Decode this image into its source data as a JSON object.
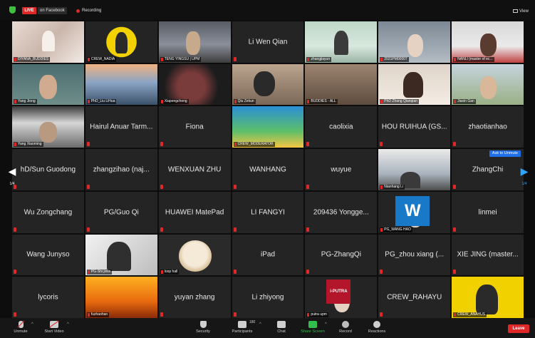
{
  "top_bar": {
    "live_badge": "LIVE",
    "live_target": "on Facebook",
    "recording": "Recording",
    "view_button": "View"
  },
  "tiles": [
    {
      "label": "DIYANA_BUDDIES",
      "video": true,
      "photo": "f1",
      "active": true
    },
    {
      "label": "CREW_NADIA",
      "video": true,
      "photo": "yellow"
    },
    {
      "label": "TENG YINGSU | UPM",
      "video": true,
      "photo": "room"
    },
    {
      "name": "Li Wen Qian",
      "video": false
    },
    {
      "label": "zhangjiayun",
      "video": true,
      "photo": "green"
    },
    {
      "label": "2021PM00007",
      "video": true,
      "photo": "gray"
    },
    {
      "label": "NANLI (master of ec...",
      "video": true,
      "photo": "red"
    },
    {
      "label": "Yang Jiong",
      "video": true,
      "photo": "teal"
    },
    {
      "label": "PhD_Liu LiHua",
      "video": true,
      "photo": "sky"
    },
    {
      "label": "Xiapengcheng",
      "video": true,
      "photo": "dark"
    },
    {
      "label": "Qiu Zekun",
      "video": true,
      "photo": "lamp"
    },
    {
      "label": "BUDDIES - ALL",
      "video": true,
      "photo": "group"
    },
    {
      "label": "PhD Zhang Qianqian",
      "video": true,
      "photo": "girl"
    },
    {
      "label": "Jiaxin Gan",
      "video": true,
      "photo": "outdoor"
    },
    {
      "label": "Yang Xiaoming",
      "video": true,
      "photo": "window"
    },
    {
      "name": "Hairul Anuar Tarm...",
      "video": false
    },
    {
      "name": "Fiona",
      "video": false
    },
    {
      "label": "CREW_MODERATOR",
      "video": true,
      "photo": "mod"
    },
    {
      "name": "caolixia",
      "video": false
    },
    {
      "name": "HOU RUIHUA (GS...",
      "video": false
    },
    {
      "name": "zhaotianhao",
      "video": false
    },
    {
      "name": "hD/Sun Guodong",
      "video": false
    },
    {
      "name": "zhangzihao (naj...",
      "video": false
    },
    {
      "name": "WENXUAN ZHU",
      "video": false
    },
    {
      "name": "WANHANG",
      "video": false
    },
    {
      "name": "wuyue",
      "video": false
    },
    {
      "label": "Nianhang Li",
      "video": true,
      "photo": "office"
    },
    {
      "name": "ZhangChi",
      "video": false,
      "ask_unmute": "Ask to Unmute"
    },
    {
      "name": "Wu Zongchang",
      "video": false
    },
    {
      "name": "PG/Guo Qi",
      "video": false
    },
    {
      "name": "HUAWEI MatePad",
      "video": false
    },
    {
      "name": "LI FANGYI",
      "video": false
    },
    {
      "name": "209436 Yongge...",
      "video": false
    },
    {
      "label": "PG_WANG HAO",
      "video": true,
      "photo": "wlogo",
      "logo_text": "W"
    },
    {
      "name": "linmei",
      "video": false
    },
    {
      "name": "Wang Junyso",
      "video": false
    },
    {
      "label": "PG-Shi jinlin",
      "video": true,
      "photo": "sketch"
    },
    {
      "label": "loop hall",
      "video": true,
      "photo": "dog"
    },
    {
      "name": "iPad",
      "video": false
    },
    {
      "name": "PG-ZhangQi",
      "video": false
    },
    {
      "name": "PG_zhou xiang (...",
      "video": false
    },
    {
      "name": "XIE JING (master...",
      "video": false
    },
    {
      "name": "lycoris",
      "video": false
    },
    {
      "label": "fuzhaohan",
      "video": true,
      "photo": "fire"
    },
    {
      "name": "yuyan zhang",
      "video": false
    },
    {
      "name": "Li zhiyong",
      "video": false
    },
    {
      "label": "putra upm",
      "video": true,
      "photo": "putra",
      "logo_text": "i-PUTRA"
    },
    {
      "name": "CREW_RAHAYU",
      "video": false
    },
    {
      "label": "CREW_ANAHUS",
      "video": true,
      "photo": "yellow2"
    }
  ],
  "pagination": {
    "left_arrow": "◀",
    "left_page": "1/4",
    "right_arrow": "▶",
    "right_page": "1/4"
  },
  "bottom_bar": {
    "unmute": "Unmute",
    "start_video": "Start Video",
    "security": "Security",
    "participants": "Participants",
    "participant_count": "180",
    "chat": "Chat",
    "share_screen": "Share Screen",
    "record": "Record",
    "reactions": "Reactions",
    "leave": "Leave"
  },
  "colors": {
    "accent_active": "#c6e84a",
    "live_red": "#e02828",
    "share_green": "#2fbf4a",
    "ask_unmute_blue": "#1e6fe8"
  }
}
